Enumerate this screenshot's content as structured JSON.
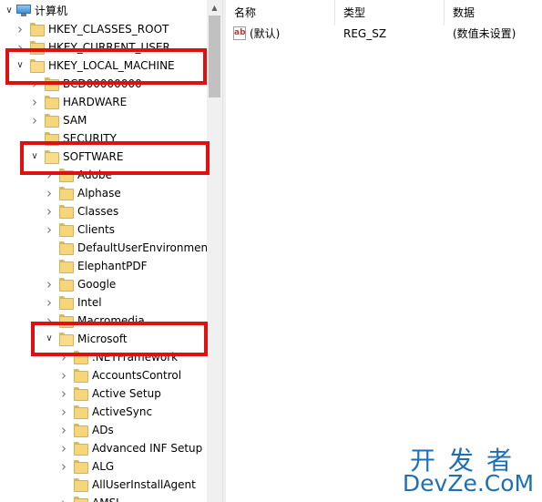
{
  "tree": {
    "root_label": "计算机",
    "items": [
      {
        "label": "HKEY_CLASSES_ROOT",
        "depth": 1,
        "state": "collapsed"
      },
      {
        "label": "HKEY_CURRENT_USER",
        "depth": 1,
        "state": "collapsed"
      },
      {
        "label": "HKEY_LOCAL_MACHINE",
        "depth": 1,
        "state": "expanded"
      },
      {
        "label": "BCD00000000",
        "depth": 2,
        "state": "collapsed"
      },
      {
        "label": "HARDWARE",
        "depth": 2,
        "state": "collapsed"
      },
      {
        "label": "SAM",
        "depth": 2,
        "state": "collapsed"
      },
      {
        "label": "SECURITY",
        "depth": 2,
        "state": "none"
      },
      {
        "label": "SOFTWARE",
        "depth": 2,
        "state": "expanded"
      },
      {
        "label": "Adobe",
        "depth": 3,
        "state": "collapsed"
      },
      {
        "label": "Alphase",
        "depth": 3,
        "state": "collapsed"
      },
      {
        "label": "Classes",
        "depth": 3,
        "state": "collapsed"
      },
      {
        "label": "Clients",
        "depth": 3,
        "state": "collapsed"
      },
      {
        "label": "DefaultUserEnvironment",
        "depth": 3,
        "state": "none"
      },
      {
        "label": "ElephantPDF",
        "depth": 3,
        "state": "none"
      },
      {
        "label": "Google",
        "depth": 3,
        "state": "collapsed"
      },
      {
        "label": "Intel",
        "depth": 3,
        "state": "collapsed"
      },
      {
        "label": "Macromedia",
        "depth": 3,
        "state": "collapsed"
      },
      {
        "label": "Microsoft",
        "depth": 3,
        "state": "expanded"
      },
      {
        "label": ".NETFramework",
        "depth": 4,
        "state": "collapsed"
      },
      {
        "label": "AccountsControl",
        "depth": 4,
        "state": "collapsed"
      },
      {
        "label": "Active Setup",
        "depth": 4,
        "state": "collapsed"
      },
      {
        "label": "ActiveSync",
        "depth": 4,
        "state": "collapsed"
      },
      {
        "label": "ADs",
        "depth": 4,
        "state": "collapsed"
      },
      {
        "label": "Advanced INF Setup",
        "depth": 4,
        "state": "collapsed"
      },
      {
        "label": "ALG",
        "depth": 4,
        "state": "collapsed"
      },
      {
        "label": "AllUserInstallAgent",
        "depth": 4,
        "state": "none"
      },
      {
        "label": "AMSI",
        "depth": 4,
        "state": "collapsed"
      }
    ]
  },
  "values_table": {
    "headers": {
      "name": "名称",
      "type": "类型",
      "data": "数据"
    },
    "rows": [
      {
        "icon": "ab",
        "name": "(默认)",
        "type": "REG_SZ",
        "data": "(数值未设置)"
      }
    ]
  },
  "watermark": {
    "line1": "开发者",
    "line2": "DevZe.CoM"
  },
  "colors": {
    "highlight_box": "#e01010",
    "folder": "#f7d57a",
    "watermark": "#1e6fb8"
  }
}
